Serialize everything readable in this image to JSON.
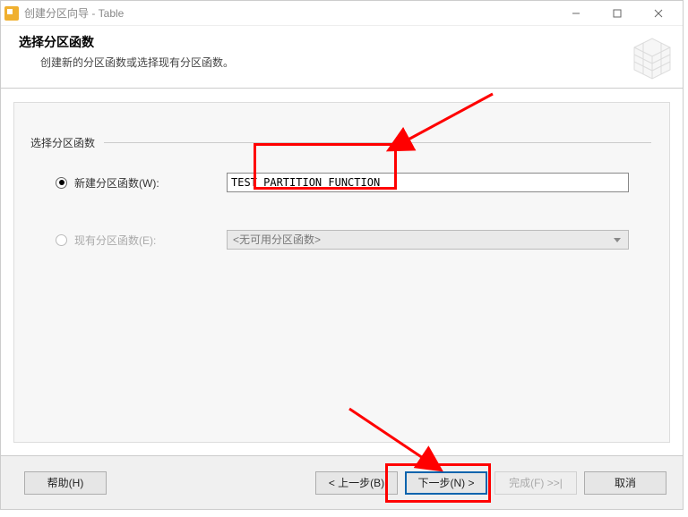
{
  "window": {
    "title": "创建分区向导 - Table"
  },
  "header": {
    "title": "选择分区函数",
    "subtitle": "创建新的分区函数或选择现有分区函数。"
  },
  "fieldset": {
    "legend": "选择分区函数",
    "newFunction": {
      "label": "新建分区函数(W):",
      "value": "TEST_PARTITION_FUNCTION"
    },
    "existingFunction": {
      "label": "现有分区函数(E):",
      "placeholder": "<无可用分区函数>"
    }
  },
  "buttons": {
    "help": "帮助(H)",
    "back": "< 上一步(B)",
    "next": "下一步(N) >",
    "finish": "完成(F) >>|",
    "cancel": "取消"
  }
}
